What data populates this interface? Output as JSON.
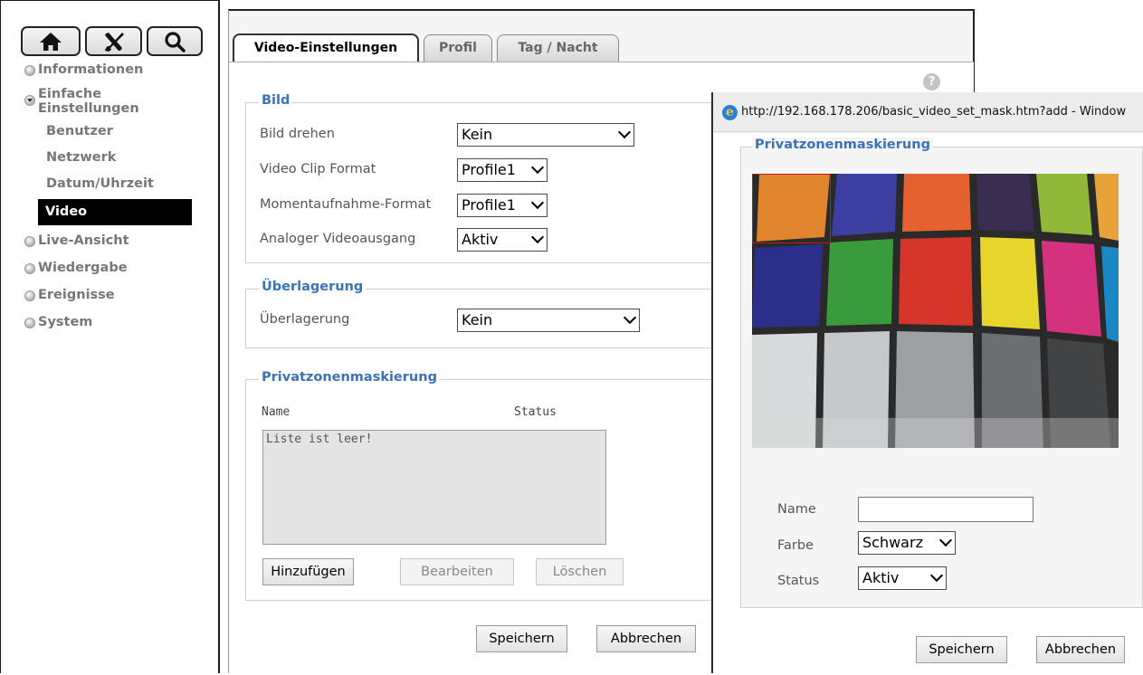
{
  "sidebar": {
    "toolbar": {
      "home_icon": "home-icon",
      "tools_icon": "tools-icon",
      "search_icon": "search-icon"
    },
    "items": [
      {
        "label": "Informationen"
      },
      {
        "label_line1": "Einfache",
        "label_line2": "Einstellungen"
      },
      {
        "label": "Live-Ansicht"
      },
      {
        "label": "Wiedergabe"
      },
      {
        "label": "Ereignisse"
      },
      {
        "label": "System"
      }
    ],
    "subitems": [
      {
        "label": "Benutzer"
      },
      {
        "label": "Netzwerk"
      },
      {
        "label": "Datum/Uhrzeit"
      },
      {
        "label": "Video"
      }
    ]
  },
  "tabs": [
    {
      "label": "Video-Einstellungen"
    },
    {
      "label": "Profil"
    },
    {
      "label": "Tag / Nacht"
    }
  ],
  "bild": {
    "title": "Bild",
    "rows": [
      {
        "label": "Bild drehen",
        "value": "Kein"
      },
      {
        "label": "Video Clip Format",
        "value": "Profile1"
      },
      {
        "label": "Momentaufnahme-Format",
        "value": "Profile1"
      },
      {
        "label": "Analoger Videoausgang",
        "value": "Aktiv"
      }
    ]
  },
  "overlay": {
    "title": "Überlagerung",
    "label": "Überlagerung",
    "value": "Kein"
  },
  "privacy": {
    "title": "Privatzonenmaskierung",
    "col_name": "Name",
    "col_status": "Status",
    "empty_text": "Liste ist leer!",
    "add_label": "Hinzufügen",
    "edit_label": "Bearbeiten",
    "delete_label": "Löschen"
  },
  "footer": {
    "save_label": "Speichern",
    "cancel_label": "Abbrechen"
  },
  "popup": {
    "title": "http://192.168.178.206/basic_video_set_mask.htm?add - Window",
    "section_title": "Privatzonenmaskierung",
    "name_label": "Name",
    "name_value": "",
    "color_label": "Farbe",
    "color_value": "Schwarz",
    "status_label": "Status",
    "status_value": "Aktiv",
    "save_label": "Speichern",
    "cancel_label": "Abbrechen"
  }
}
